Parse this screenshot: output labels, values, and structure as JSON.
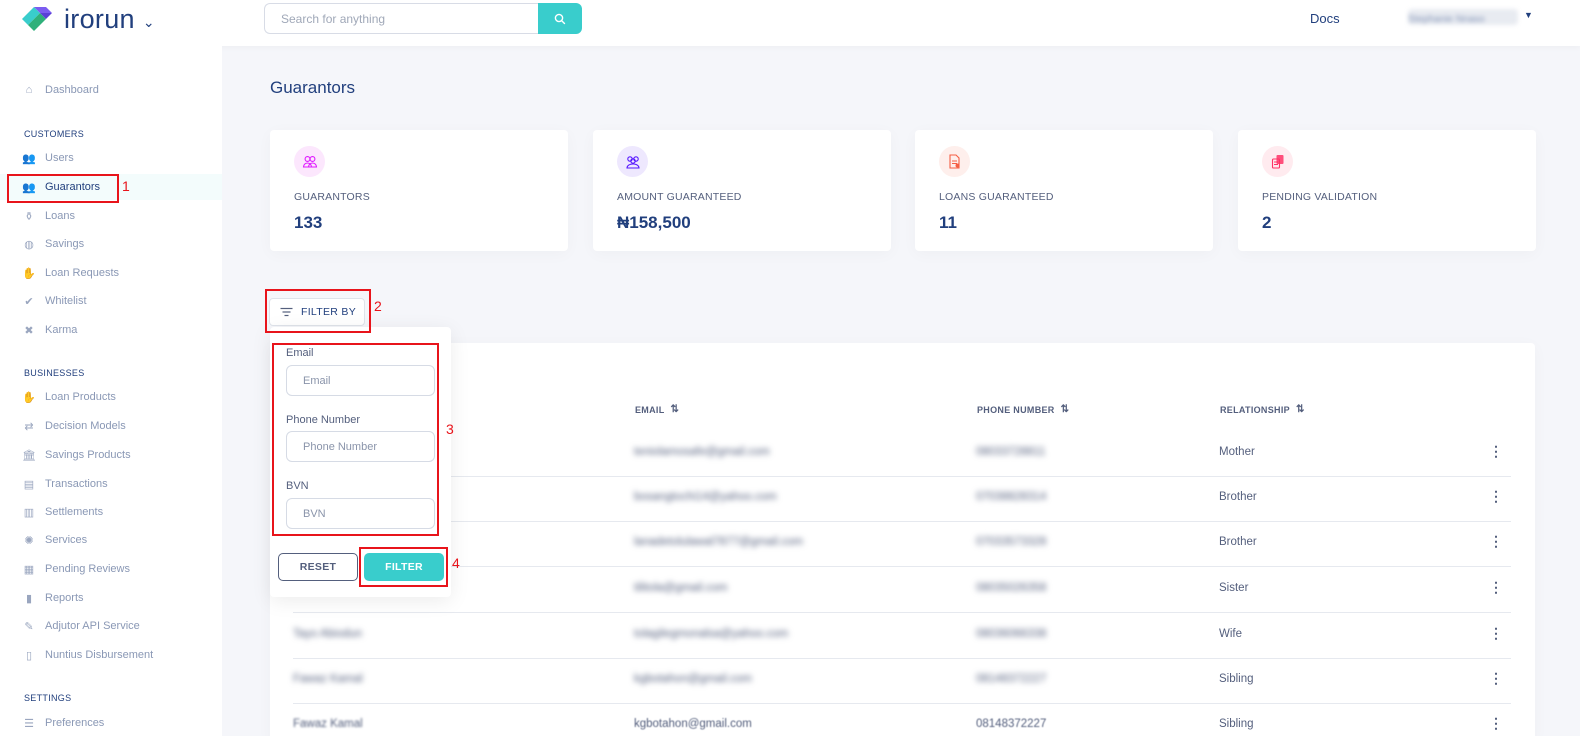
{
  "topbar": {
    "logo_text": "irorun",
    "search_placeholder": "Search for anything",
    "docs_label": "Docs",
    "user_name": "Stephanie Nnaso"
  },
  "sidebar": {
    "dashboard": "Dashboard",
    "sections": {
      "customers": "CUSTOMERS",
      "businesses": "BUSINESSES",
      "settings": "SETTINGS"
    },
    "customers": [
      "Users",
      "Guarantors",
      "Loans",
      "Savings",
      "Loan Requests",
      "Whitelist",
      "Karma"
    ],
    "businesses": [
      "Loan Products",
      "Decision Models",
      "Savings Products",
      "Transactions",
      "Settlements",
      "Services",
      "Pending Reviews",
      "Reports",
      "Adjutor API Service",
      "Nuntius Disbursement"
    ],
    "settings": [
      "Preferences"
    ]
  },
  "page": {
    "title": "Guarantors"
  },
  "stats": [
    {
      "label": "GUARANTORS",
      "value": "133",
      "icon": "guarantors-icon"
    },
    {
      "label": "AMOUNT GUARANTEED",
      "value": "₦158,500",
      "icon": "amount-icon"
    },
    {
      "label": "LOANS GUARANTEED",
      "value": "11",
      "icon": "loans-doc-icon"
    },
    {
      "label": "PENDING VALIDATION",
      "value": "2",
      "icon": "coins-icon"
    }
  ],
  "filter": {
    "button_label": "FILTER BY",
    "email_label": "Email",
    "email_placeholder": "Email",
    "phone_label": "Phone Number",
    "phone_placeholder": "Phone Number",
    "bvn_label": "BVN",
    "bvn_placeholder": "BVN",
    "reset_label": "RESET",
    "filter_label": "FILTER"
  },
  "table": {
    "headers": {
      "email": "EMAIL",
      "phone": "PHONE NUMBER",
      "relationship": "RELATIONSHIP"
    },
    "rows": [
      {
        "name": "",
        "email": "teniolamosafe@gmail.com",
        "phone": "08033728811",
        "relationship": "Mother"
      },
      {
        "name": "",
        "email": "bosangtochi14@yahoo.com",
        "phone": "07038828314",
        "relationship": "Brother"
      },
      {
        "name": "",
        "email": "lanadetolulawal7877@gmail.com",
        "phone": "07033573328",
        "relationship": "Brother"
      },
      {
        "name": "",
        "email": "tilitola@gmail.com",
        "phone": "08035026358",
        "relationship": "Sister"
      },
      {
        "name": "Tayo Abiodun",
        "email": "tolagilegmonalsa@yahoo.com",
        "phone": "08036066338",
        "relationship": "Wife"
      },
      {
        "name": "Fawaz Kamal",
        "email": "kgbotahon@gmail.com",
        "phone": "08148372227",
        "relationship": "Sibling"
      },
      {
        "name": "Fawaz Kamal",
        "email": "kgbotahon@gmail.com",
        "phone": "08148372227",
        "relationship": "Sibling"
      }
    ]
  },
  "annotations": [
    "1",
    "2",
    "3",
    "4"
  ]
}
